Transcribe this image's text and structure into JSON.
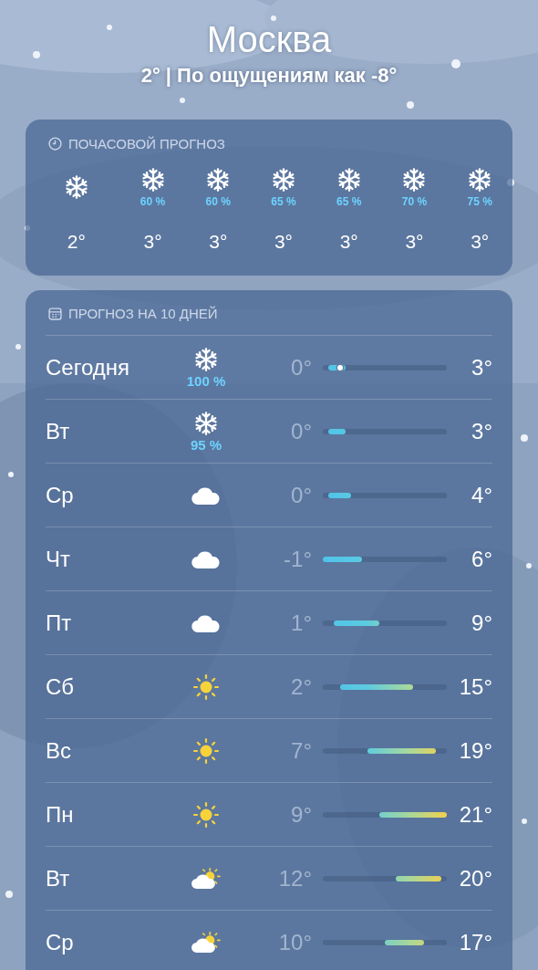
{
  "city": "Москва",
  "summary": "2° | По ощущениям как -8°",
  "hourly": {
    "title": "ПОЧАСОВОЙ ПРОГНОЗ",
    "items": [
      {
        "kind": "snow",
        "temp": "2°"
      },
      {
        "kind": "snow",
        "precip": "60 %",
        "temp": "3°"
      },
      {
        "kind": "snow",
        "precip": "60 %",
        "temp": "3°"
      },
      {
        "kind": "snow",
        "precip": "65 %",
        "temp": "3°"
      },
      {
        "kind": "snow",
        "precip": "65 %",
        "temp": "3°"
      },
      {
        "kind": "snow",
        "precip": "70 %",
        "temp": "3°"
      },
      {
        "kind": "snow",
        "precip": "75 %",
        "temp": "3°"
      }
    ]
  },
  "daily": {
    "title": "ПРОГНОЗ НА 10 ДНЕЙ",
    "days": [
      {
        "day": "Сегодня",
        "kind": "snow",
        "precip": "100 %",
        "low": "0°",
        "high": "3°",
        "now": {
          "level": 0.14
        }
      },
      {
        "day": "Вт",
        "kind": "snow",
        "precip": "95 %",
        "low": "0°",
        "high": "3°"
      },
      {
        "day": "Ср",
        "kind": "cloud",
        "low": "0°",
        "high": "4°"
      },
      {
        "day": "Чт",
        "kind": "cloud",
        "low": "-1°",
        "high": "6°"
      },
      {
        "day": "Пт",
        "kind": "cloud",
        "low": "1°",
        "high": "9°"
      },
      {
        "day": "Сб",
        "kind": "sun",
        "low": "2°",
        "high": "15°"
      },
      {
        "day": "Вс",
        "kind": "sun",
        "low": "7°",
        "high": "19°"
      },
      {
        "day": "Пн",
        "kind": "sun",
        "low": "9°",
        "high": "21°"
      },
      {
        "day": "Вт",
        "kind": "sun-cloud",
        "low": "12°",
        "high": "20°"
      },
      {
        "day": "Ср",
        "kind": "sun-cloud",
        "low": "10°",
        "high": "17°"
      }
    ]
  }
}
